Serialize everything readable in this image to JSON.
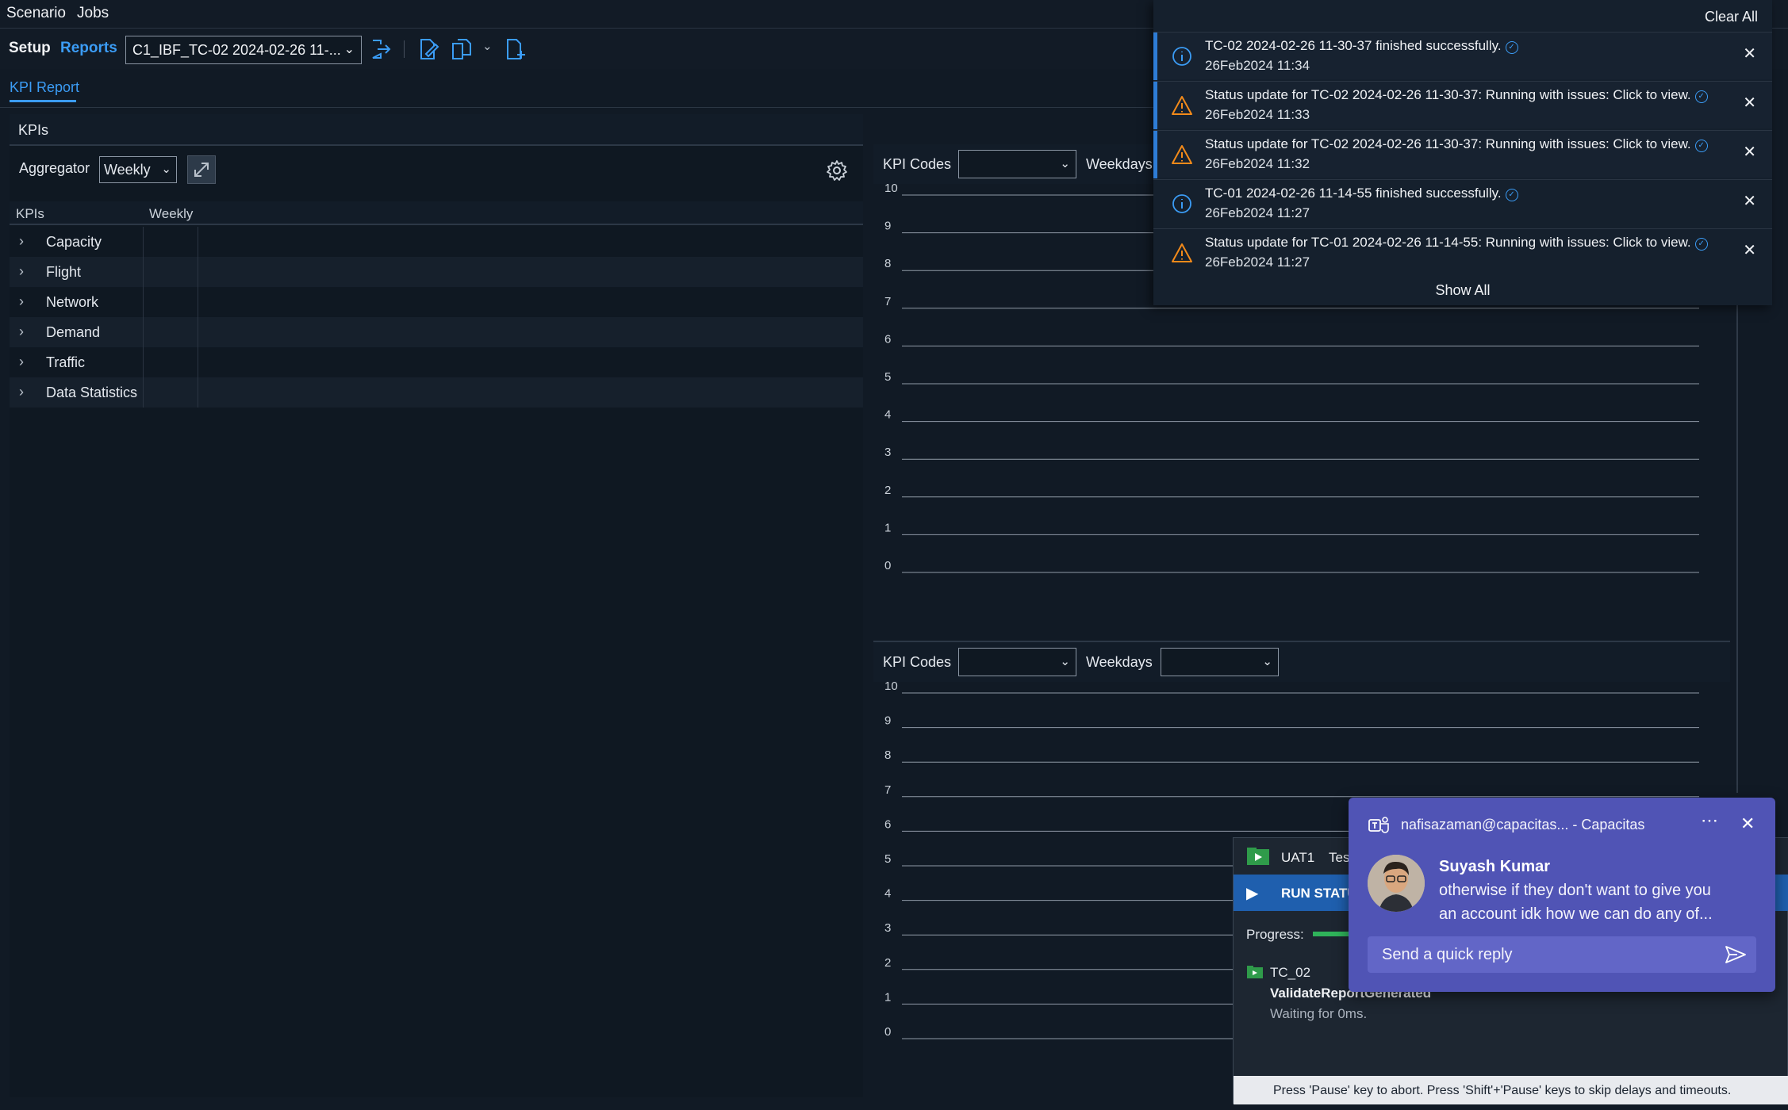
{
  "menu": {
    "scenario": "Scenario",
    "jobs": "Jobs"
  },
  "toolbar": {
    "setup": "Setup",
    "reports": "Reports",
    "scenario_select": "C1_IBF_TC-02 2024-02-26 11-...",
    "icons": [
      "exit-icon",
      "edit-document-icon",
      "copy-document-icon",
      "chevron-down-icon",
      "new-document-icon"
    ]
  },
  "subtabs": {
    "kpi_report": "KPI Report"
  },
  "kpi_panel": {
    "title": "KPIs",
    "aggregator_label": "Aggregator",
    "aggregator_value": "Weekly",
    "columns": [
      "KPIs",
      "Weekly"
    ],
    "rows": [
      "Capacity",
      "Flight",
      "Network",
      "Demand",
      "Traffic",
      "Data Statistics"
    ]
  },
  "chart_top": {
    "kpi_codes_label": "KPI Codes",
    "weekdays_label": "Weekdays"
  },
  "chart_bottom": {
    "kpi_codes_label": "KPI Codes",
    "weekdays_label": "Weekdays"
  },
  "chart_data": [
    {
      "type": "line",
      "series": [],
      "ylim": [
        0,
        10
      ],
      "yticks": [
        "10",
        "9",
        "8",
        "7",
        "6",
        "5",
        "4",
        "3",
        "2",
        "1",
        "0"
      ],
      "grid": true
    },
    {
      "type": "line",
      "series": [],
      "ylim": [
        0,
        10
      ],
      "yticks": [
        "10",
        "9",
        "8",
        "7",
        "6",
        "5",
        "4",
        "3",
        "2",
        "1",
        "0"
      ],
      "grid": true
    }
  ],
  "notifications": {
    "clear_all": "Clear All",
    "show_all": "Show All",
    "items": [
      {
        "type": "info",
        "message": "TC-02 2024-02-26 11-30-37 finished successfully.",
        "time": "26Feb2024 11:34"
      },
      {
        "type": "warning",
        "message": "Status update for TC-02 2024-02-26 11-30-37: Running with issues: Click to view.",
        "time": "26Feb2024 11:33"
      },
      {
        "type": "warning",
        "message": "Status update for TC-02 2024-02-26 11-30-37: Running with issues: Click to view.",
        "time": "26Feb2024 11:32"
      },
      {
        "type": "info",
        "message": "TC-01 2024-02-26 11-14-55 finished successfully.",
        "time": "26Feb2024 11:27"
      },
      {
        "type": "warning",
        "message": "Status update for TC-01 2024-02-26 11-14-55: Running with issues: Click to view.",
        "time": "26Feb2024 11:27"
      }
    ]
  },
  "uat": {
    "title": "UAT1",
    "title_suffix": "Tes",
    "run_status": "RUN STATU",
    "progress_label": "Progress:",
    "test_name": "TC_02",
    "step": "ValidateReportGenerated",
    "waiting": "Waiting for 0ms.",
    "footer": "Press 'Pause' key to abort. Press 'Shift'+'Pause' keys to skip delays and timeouts."
  },
  "teams": {
    "title": "nafisazaman@capacitas... - Capacitas",
    "sender": "Suyash Kumar",
    "message_line1": "otherwise if they don't want to give you",
    "message_line2": "an account idk how we can do any of...",
    "reply_placeholder": "Send a quick reply"
  },
  "colors": {
    "accent": "#3b9cf5",
    "warning": "#f28a1a",
    "teams": "#5054b5",
    "run_status_bg": "#1f5fae"
  }
}
